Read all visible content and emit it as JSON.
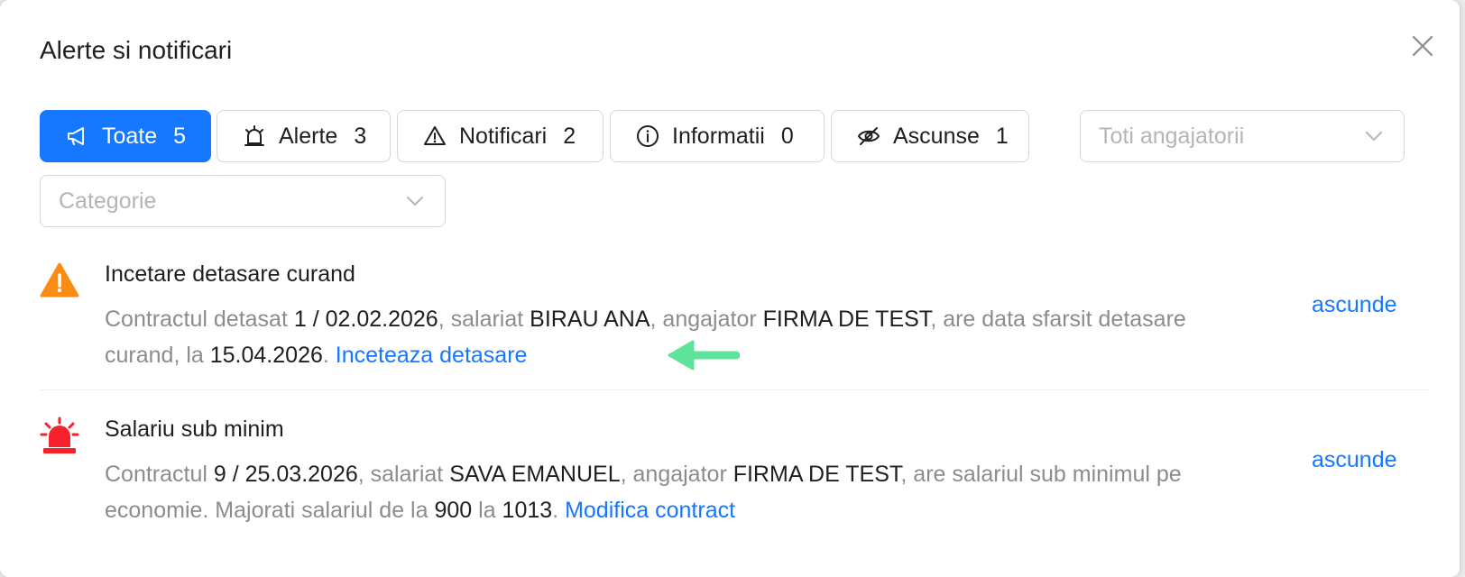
{
  "modal": {
    "title": "Alerte si notificari"
  },
  "tabs": [
    {
      "label": "Toate",
      "count": "5",
      "icon": "megaphone-icon",
      "active": true
    },
    {
      "label": "Alerte",
      "count": "3",
      "icon": "alarm-icon",
      "active": false
    },
    {
      "label": "Notificari",
      "count": "2",
      "icon": "warning-icon",
      "active": false
    },
    {
      "label": "Informatii",
      "count": "0",
      "icon": "info-icon",
      "active": false
    },
    {
      "label": "Ascunse",
      "count": "1",
      "icon": "eye-slash-icon",
      "active": false
    }
  ],
  "filters": {
    "employer_placeholder": "Toti angajatorii",
    "category_placeholder": "Categorie"
  },
  "alerts": [
    {
      "icon": "warning-triangle-icon",
      "title": "Incetare detasare curand",
      "body": {
        "t1": "Contractul detasat ",
        "contract": "1 / 02.02.2026",
        "t2": ", salariat ",
        "employee": "BIRAU ANA",
        "t3": ", angajator ",
        "employer": "FIRMA DE TEST",
        "t4": ", are data sfarsit detasare curand, la ",
        "date": "15.04.2026",
        "t5": ". ",
        "action": "Inceteaza detasare"
      },
      "hide_label": "ascunde"
    },
    {
      "icon": "siren-icon",
      "title": "Salariu sub minim",
      "body": {
        "t1": "Contractul ",
        "contract": "9 / 25.03.2026",
        "t2": ", salariat ",
        "employee": "SAVA EMANUEL",
        "t3": ", angajator ",
        "employer": "FIRMA DE TEST",
        "t4": ", are salariul sub minimul pe economie. Majorati salariul de la ",
        "from": "900",
        "t5": " la ",
        "to": "1013",
        "t6": ". ",
        "action": "Modifica contract"
      },
      "hide_label": "ascunde"
    }
  ],
  "colors": {
    "accent": "#1677ff",
    "warning": "#fa8c16",
    "danger": "#f5222d",
    "arrow": "#5ee39a"
  }
}
